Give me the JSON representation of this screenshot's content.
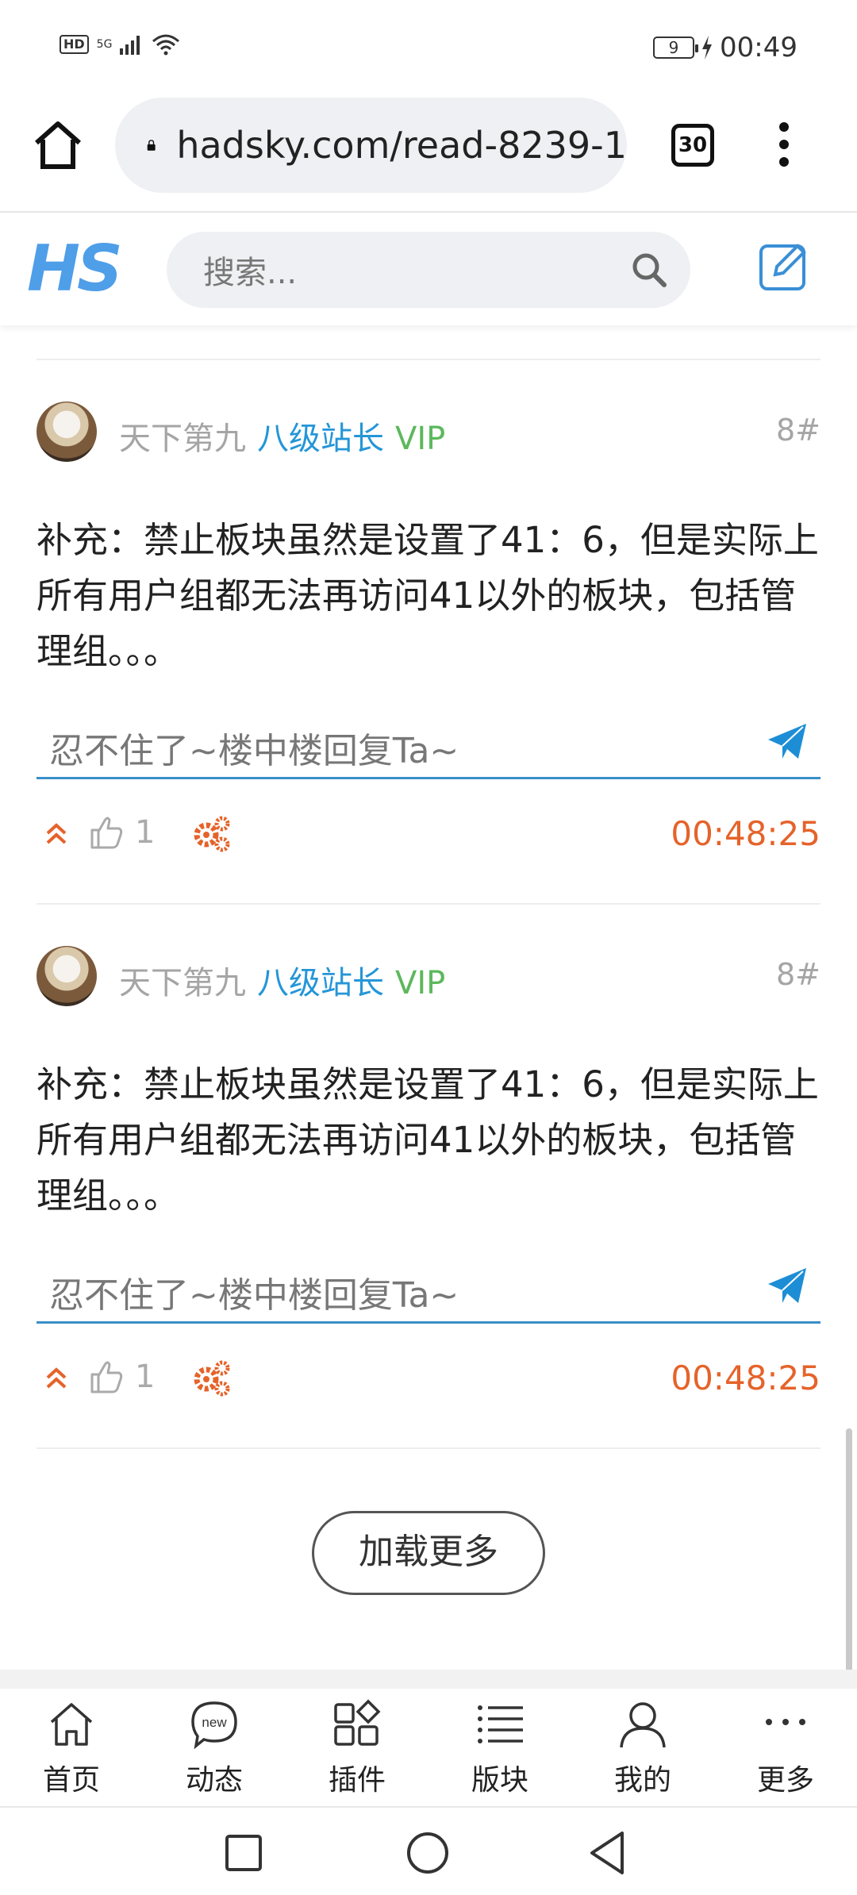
{
  "status_bar": {
    "left_badge": "HD",
    "network": "5G",
    "battery": "9",
    "time": "00:49"
  },
  "browser": {
    "url": "hadsky.com/read-8239-1",
    "tab_count": "30"
  },
  "site_header": {
    "logo_text": "HS",
    "search_placeholder": "搜索..."
  },
  "posts": [
    {
      "author": "天下第九",
      "rank": "八级站长",
      "vip": "VIP",
      "floor": "8#",
      "content": "补充：禁止板块虽然是设置了41：6，但是实际上所有用户组都无法再访问41以外的板块，包括管理组。。。",
      "reply_placeholder": "忍不住了~楼中楼回复Ta~",
      "likes": "1",
      "time": "00:48:25"
    },
    {
      "author": "天下第九",
      "rank": "八级站长",
      "vip": "VIP",
      "floor": "8#",
      "content": "补充：禁止板块虽然是设置了41：6，但是实际上所有用户组都无法再访问41以外的板块，包括管理组。。。",
      "reply_placeholder": "忍不住了~楼中楼回复Ta~",
      "likes": "1",
      "time": "00:48:25"
    }
  ],
  "load_more_label": "加载更多",
  "bottom_nav": [
    {
      "label": "首页",
      "icon": "home-icon"
    },
    {
      "label": "动态",
      "icon": "new-chat-icon",
      "badge": "new"
    },
    {
      "label": "插件",
      "icon": "plugins-icon"
    },
    {
      "label": "版块",
      "icon": "list-icon"
    },
    {
      "label": "我的",
      "icon": "user-icon"
    },
    {
      "label": "更多",
      "icon": "more-icon"
    }
  ],
  "colors": {
    "accent_blue": "#2596d8",
    "vip_green": "#5cb85c",
    "time_orange": "#e5632a",
    "logo_blue": "#4f9ee8"
  }
}
